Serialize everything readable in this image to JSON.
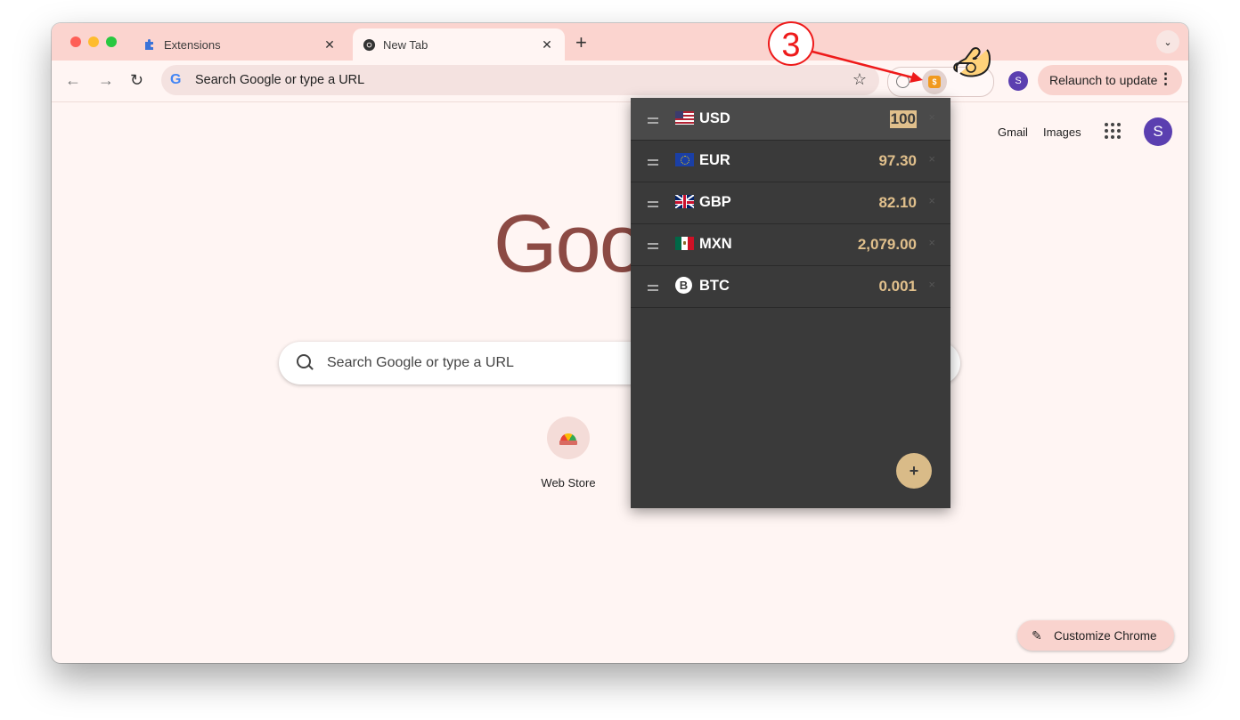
{
  "tabs": [
    {
      "label": "Extensions",
      "icon": "puzzle-icon"
    },
    {
      "label": "New Tab",
      "icon": "chrome-icon"
    }
  ],
  "toolbar": {
    "omnibox_text": "Search Google or type a URL",
    "relaunch_label": "Relaunch to update",
    "profile_initial": "S"
  },
  "ntp": {
    "logo_text": "Goo",
    "gmail": "Gmail",
    "images": "Images",
    "avatar_initial": "S",
    "search_placeholder": "Search Google or type a URL",
    "shortcut_label": "Web Store",
    "customize_label": "Customize Chrome"
  },
  "converter": {
    "rows": [
      {
        "code": "USD",
        "value": "100",
        "flag": "us-flag-icon"
      },
      {
        "code": "EUR",
        "value": "97.30",
        "flag": "eu-flag-icon"
      },
      {
        "code": "GBP",
        "value": "82.10",
        "flag": "gb-flag-icon"
      },
      {
        "code": "MXN",
        "value": "2,079.00",
        "flag": "mx-flag-icon"
      },
      {
        "code": "BTC",
        "value": "0.001",
        "flag": "btc-icon"
      }
    ],
    "add_label": "+",
    "remove_label": "×",
    "accent_color": "#e1c08c",
    "background_color": "#3a3a3a"
  },
  "annotation": {
    "step": "3",
    "color": "#ee1a1a"
  }
}
